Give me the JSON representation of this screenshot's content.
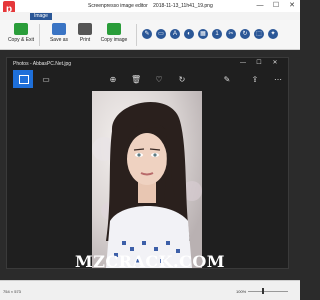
{
  "titlebar": {
    "app_title": "Screenpresso image editor",
    "file_name": "2018-11-13_11h41_19.png",
    "app_logo_glyph": "p"
  },
  "ribbon": {
    "tab": "Image",
    "buttons": [
      {
        "label": "Copy & Exit",
        "icon": "copy-exit-icon"
      },
      {
        "label": "Save as",
        "icon": "save-icon"
      },
      {
        "label": "Print",
        "icon": "print-icon"
      },
      {
        "label": "Copy image",
        "icon": "copy-image-icon"
      }
    ],
    "tools": [
      {
        "glyph": "✎",
        "name": "pen-tool-icon"
      },
      {
        "glyph": "▭",
        "name": "rectangle-tool-icon"
      },
      {
        "glyph": "A",
        "name": "text-tool-icon"
      },
      {
        "glyph": "◐",
        "name": "highlight-tool-icon"
      },
      {
        "glyph": "▦",
        "name": "blur-tool-icon"
      },
      {
        "glyph": "1",
        "name": "number-tool-icon"
      },
      {
        "glyph": "✂",
        "name": "crop-tool-icon"
      },
      {
        "glyph": "↻",
        "name": "rotate-tool-icon"
      },
      {
        "glyph": "⬚",
        "name": "frame-tool-icon"
      },
      {
        "glyph": "✦",
        "name": "effects-tool-icon"
      }
    ]
  },
  "photos_window": {
    "title": "Photos - AbbasPC.Net.jpg",
    "toolbar": [
      {
        "glyph": "⊕",
        "name": "zoom-icon"
      },
      {
        "glyph": "🗑",
        "name": "delete-icon"
      },
      {
        "glyph": "♡",
        "name": "favorite-icon"
      },
      {
        "glyph": "↻",
        "name": "rotate-icon"
      },
      {
        "glyph": "✎",
        "name": "edit-icon"
      },
      {
        "glyph": "⇪",
        "name": "share-icon"
      },
      {
        "glyph": "⋯",
        "name": "more-icon"
      }
    ]
  },
  "status": {
    "dimensions": "754 × 573",
    "zoom": "100%"
  },
  "watermark": "MZCRACK.COM"
}
